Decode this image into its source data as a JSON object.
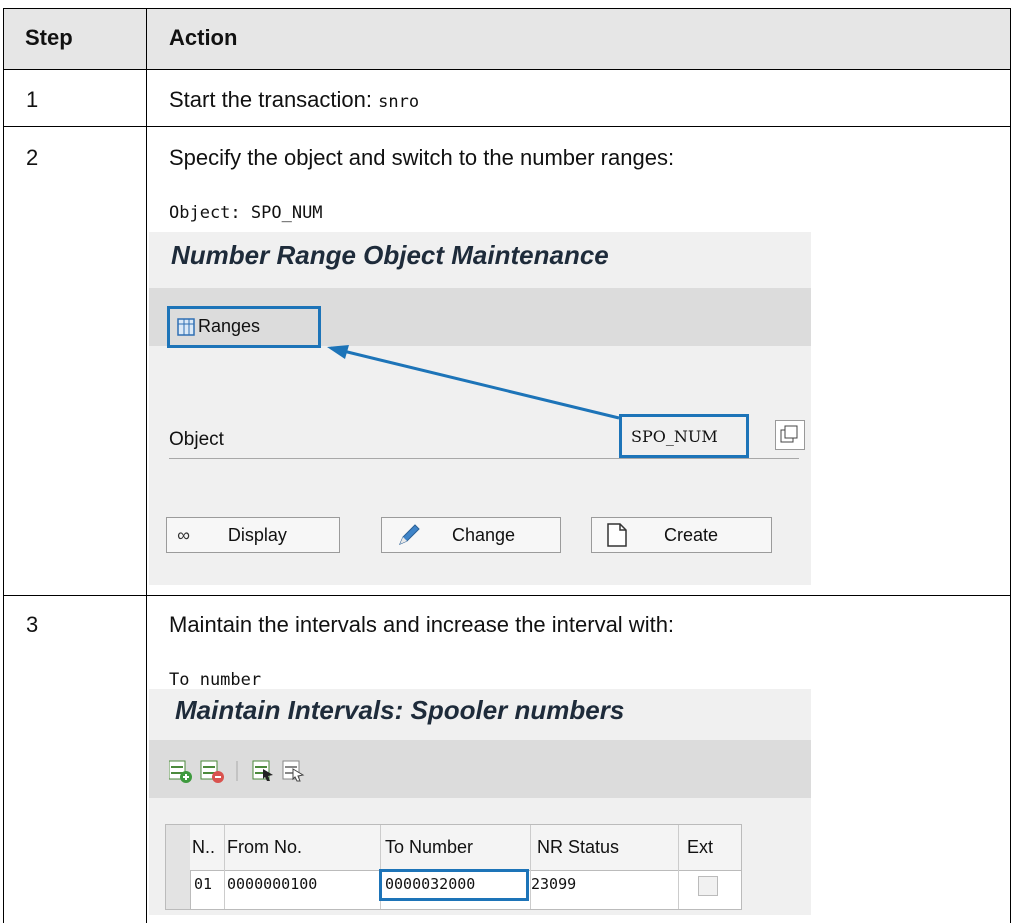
{
  "table": {
    "headers": [
      "Step",
      "Action"
    ],
    "rows": [
      {
        "step": "1",
        "text": "Start the transaction: ",
        "code": "snro"
      },
      {
        "step": "2",
        "text": "Specify the object and switch to the number ranges:",
        "code_label": "Object: ",
        "code_value": "SPO_NUM"
      },
      {
        "step": "3",
        "text": "Maintain the intervals and increase the interval with:",
        "code_value": "To number"
      }
    ]
  },
  "screen1": {
    "title": "Number Range Object Maintenance",
    "ranges_button": "Ranges",
    "object_label": "Object",
    "object_value": "SPO_NUM",
    "buttons": [
      "Display",
      "Change",
      "Create"
    ]
  },
  "screen2": {
    "title": "Maintain Intervals: Spooler numbers",
    "columns": [
      "N..",
      "From No.",
      "To Number",
      "NR Status",
      "Ext"
    ],
    "row": {
      "n": "01",
      "from": "0000000100",
      "to": "0000032000",
      "status": "23099"
    }
  },
  "colors": {
    "highlight": "#1d74b8",
    "header_bg": "#e6e6e6"
  }
}
